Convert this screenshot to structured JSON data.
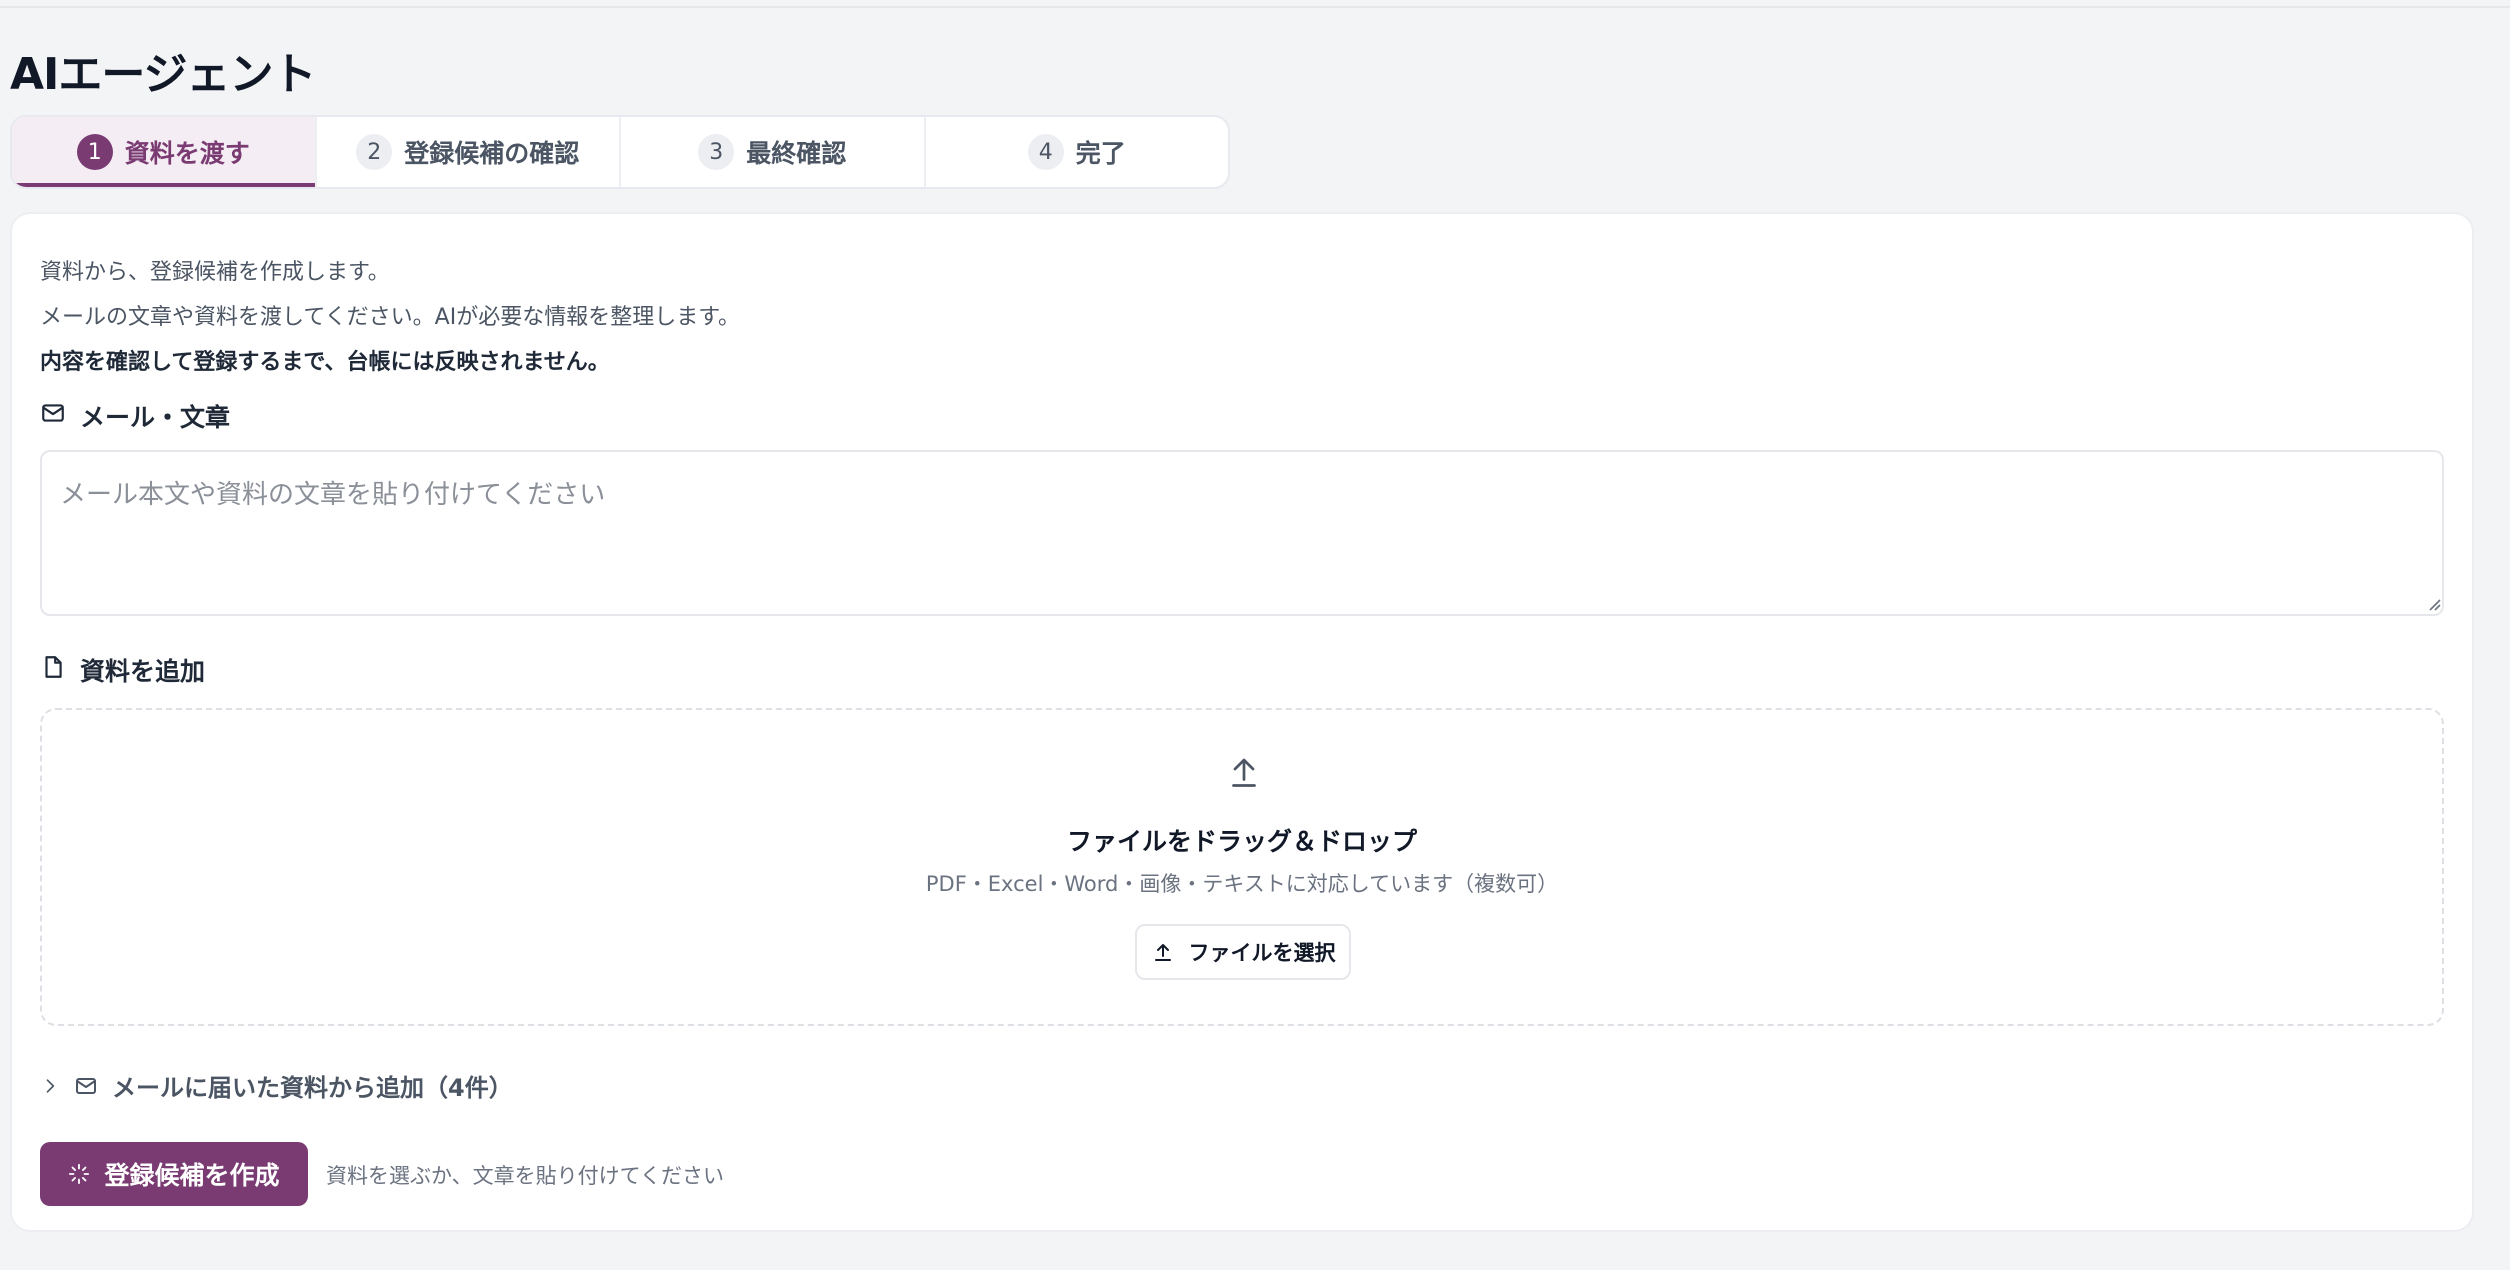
{
  "page": {
    "title": "AIエージェント"
  },
  "stepper": {
    "steps": [
      {
        "num": "1",
        "label": "資料を渡す",
        "active": true
      },
      {
        "num": "2",
        "label": "登録候補の確認",
        "active": false
      },
      {
        "num": "3",
        "label": "最終確認",
        "active": false
      },
      {
        "num": "4",
        "label": "完了",
        "active": false
      }
    ]
  },
  "intro": {
    "line1": "資料から、登録候補を作成します。",
    "line2": "メールの文章や資料を渡してください。AIが必要な情報を整理します。",
    "line3": "内容を確認して登録するまで、台帳には反映されません。"
  },
  "mail_section": {
    "label": "メール・文章",
    "icon": "mail-icon",
    "placeholder": "メール本文や資料の文章を貼り付けてください",
    "value": ""
  },
  "file_section": {
    "label": "資料を追加",
    "icon": "file-icon",
    "dropzone_title": "ファイルをドラッグ＆ドロップ",
    "dropzone_sub": "PDF・Excel・Word・画像・テキストに対応しています（複数可）",
    "choose_button": "ファイルを選択"
  },
  "mail_attachments": {
    "label": "メールに届いた資料から追加（4件）"
  },
  "actions": {
    "create_button": "登録候補を作成",
    "hint": "資料を選ぶか、文章を貼り付けてください"
  },
  "colors": {
    "accent": "#7a3b73",
    "accent_bg": "#f4edf3",
    "page_bg": "#f3f4f6"
  }
}
